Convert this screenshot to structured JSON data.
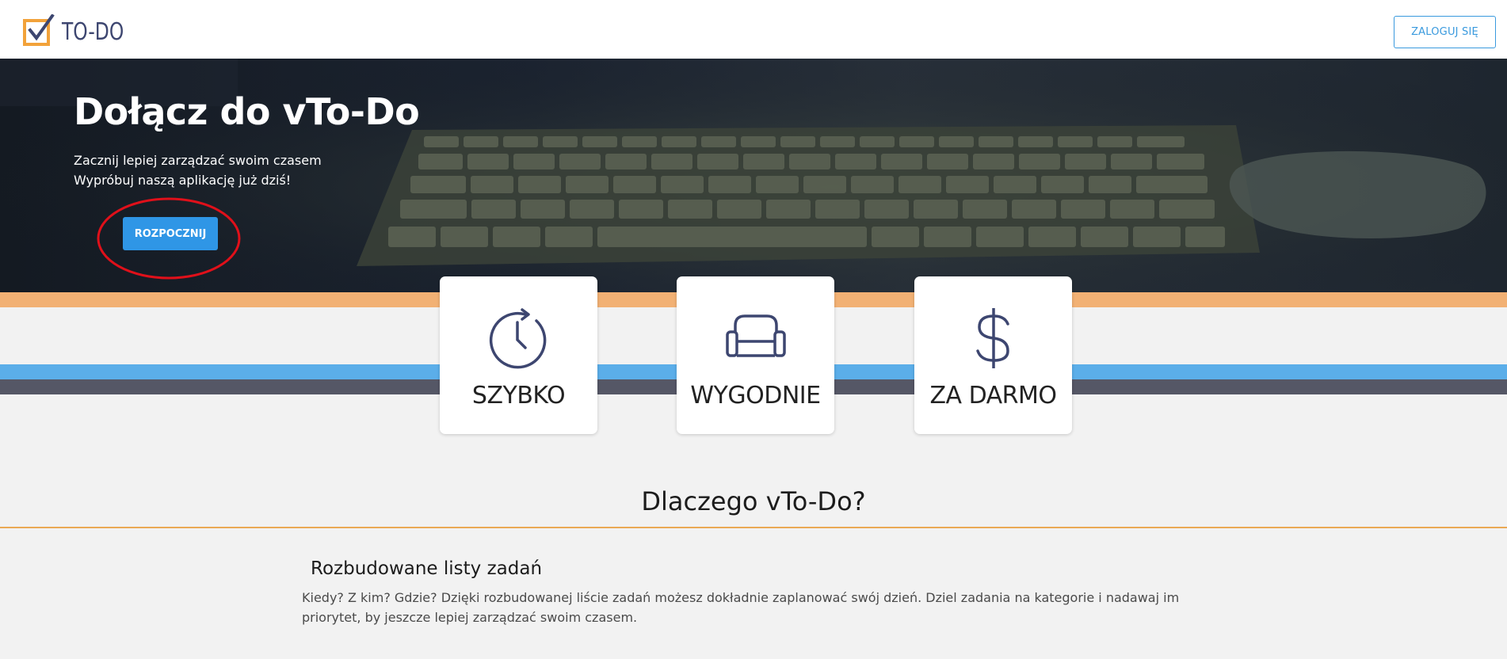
{
  "navbar": {
    "logo_text": "TO-DO",
    "login_label": "ZALOGUJ SIĘ"
  },
  "hero": {
    "title": "Dołącz do vTo-Do",
    "subtitle_line1": "Zacznij lepiej zarządzać swoim czasem",
    "subtitle_line2": "Wypróbuj naszą aplikację już dziś!",
    "cta_label": "ROZPOCZNIJ"
  },
  "features": [
    {
      "label": "SZYBKO",
      "icon": "clock-icon"
    },
    {
      "label": "WYGODNIE",
      "icon": "sofa-icon"
    },
    {
      "label": "ZA DARMO",
      "icon": "dollar-icon"
    }
  ],
  "why": {
    "heading": "Dlaczego vTo-Do?",
    "feature_title": "Rozbudowane listy zadań",
    "feature_desc_line1": "Kiedy? Z kim? Gdzie? Dzięki rozbudowanej liście zadań możesz dokładnie zaplanować swój dzień. Dziel zadania na kategorie i nadawaj im",
    "feature_desc_line2": "priorytet, by jeszcze lepiej zarządzać swoim czasem."
  },
  "colors": {
    "accent_blue": "#2f96e6",
    "stripe_orange": "#f2b174",
    "stripe_blue": "#5baee9",
    "stripe_dark": "#555766",
    "icon_navy": "#3d4670",
    "annotation_red": "#e0101a"
  }
}
